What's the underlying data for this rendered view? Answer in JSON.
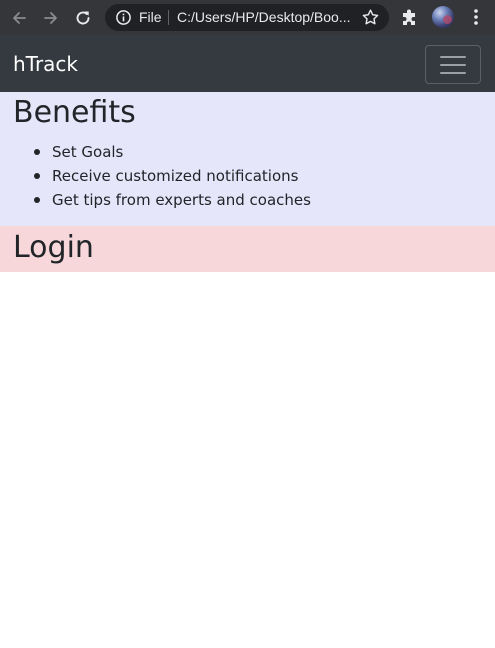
{
  "browser": {
    "site_chip": "File",
    "url": "C:/Users/HP/Desktop/Boo..."
  },
  "navbar": {
    "brand": "hTrack",
    "bg_color": "#343a40"
  },
  "benefits": {
    "heading": "Benefits",
    "items": [
      "Set Goals",
      "Receive customized notifications",
      "Get tips from experts and coaches"
    ],
    "bg_color": "#e6e6fa"
  },
  "login": {
    "heading": "Login",
    "bg_color": "#f8d7da"
  },
  "icons": {
    "back": "arrow-left-icon",
    "forward": "arrow-right-icon",
    "reload": "reload-icon",
    "info": "info-icon",
    "bookmark": "star-icon",
    "extensions": "puzzle-icon",
    "profile": "avatar",
    "menu": "kebab-menu-icon",
    "toggler": "hamburger-icon"
  }
}
